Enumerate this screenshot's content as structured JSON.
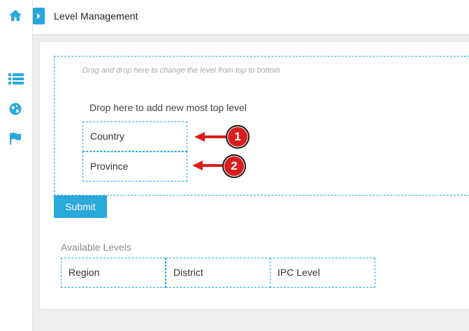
{
  "header": {
    "title": "Level Management"
  },
  "sidebar": {
    "icons": [
      "home-icon",
      "list-icon",
      "globe-icon",
      "flag-icon"
    ],
    "accent": "#29a8dc"
  },
  "level_editor": {
    "hint": "Drag and drop here to change the level from top to bottom",
    "drop_top_label": "Drop here to add new most top level",
    "levels": [
      {
        "label": "Country",
        "badge": "1"
      },
      {
        "label": "Province",
        "badge": "2"
      }
    ],
    "submit_label": "Submit"
  },
  "available": {
    "title": "Available Levels",
    "items": [
      "Region",
      "District",
      "IPC Level"
    ]
  },
  "colors": {
    "accent": "#29a8dc",
    "annotation": "#d81e1e"
  }
}
